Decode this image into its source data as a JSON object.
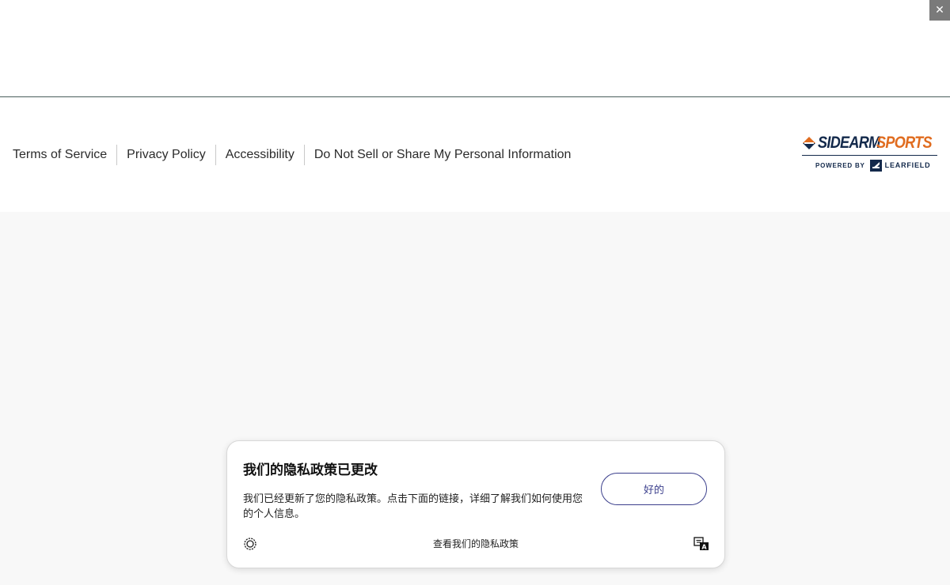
{
  "top_bar": {
    "close_icon": "close-icon",
    "close_glyph": "✕"
  },
  "footer": {
    "links": [
      {
        "label": "Terms of Service"
      },
      {
        "label": "Privacy Policy"
      },
      {
        "label": "Accessibility"
      },
      {
        "label": "Do Not Sell or Share My Personal Information"
      }
    ],
    "logo": {
      "word_a": "SIDEARM",
      "word_b": "SPORTS",
      "powered_by": "POWERED BY",
      "partner": "LEARFIELD",
      "brand_navy": "#13294b",
      "brand_orange": "#e06c1f"
    }
  },
  "privacy_dialog": {
    "title": "我们的隐私政策已更改",
    "body": "我们已经更新了您的隐私政策。点击下面的链接，详细了解我们如何使用您的个人信息。",
    "ok_label": "好的",
    "view_policy_label": "查看我们的隐私政策",
    "left_icon": "settings-badge-icon",
    "right_icon": "translate-icon",
    "accent_color": "#3b3f8c"
  }
}
